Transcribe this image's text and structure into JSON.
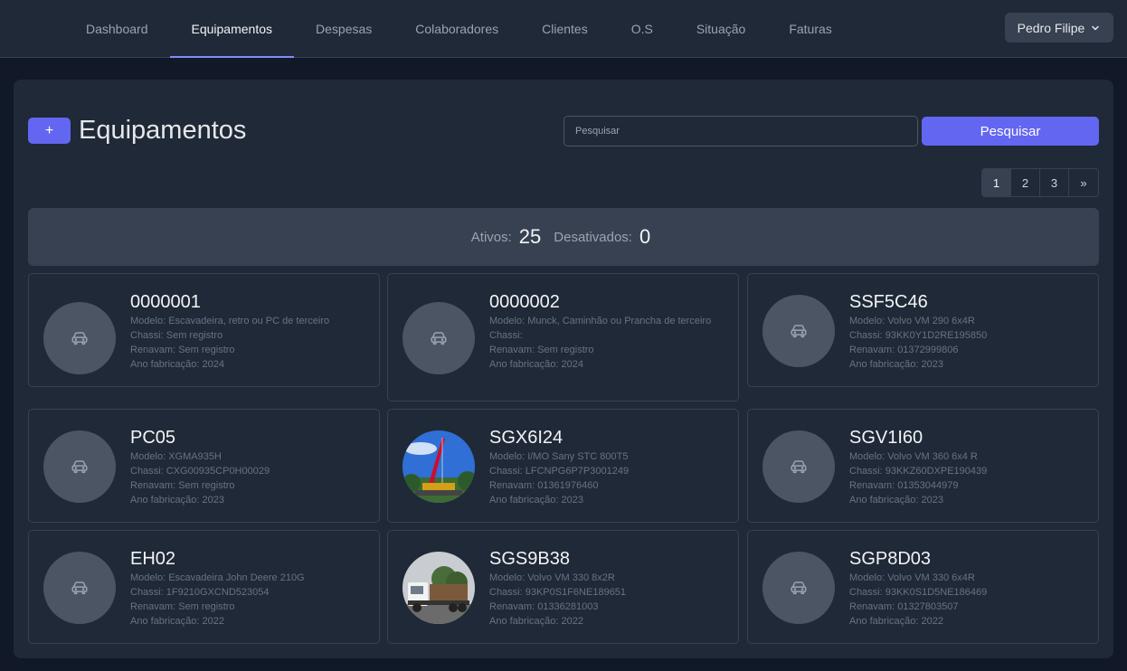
{
  "nav": {
    "items": [
      {
        "label": "Dashboard",
        "active": false
      },
      {
        "label": "Equipamentos",
        "active": true
      },
      {
        "label": "Despesas",
        "active": false
      },
      {
        "label": "Colaboradores",
        "active": false
      },
      {
        "label": "Clientes",
        "active": false
      },
      {
        "label": "O.S",
        "active": false
      },
      {
        "label": "Situação",
        "active": false
      },
      {
        "label": "Faturas",
        "active": false
      }
    ],
    "user_label": "Pedro Filipe"
  },
  "page": {
    "add_label": "+",
    "title": "Equipamentos",
    "search_placeholder": "Pesquisar",
    "search_button": "Pesquisar"
  },
  "pagination": {
    "pages": [
      "1",
      "2",
      "3",
      "»"
    ],
    "current": "1"
  },
  "stats": {
    "active_label": "Ativos:",
    "active_value": "25",
    "inactive_label": "Desativados:",
    "inactive_value": "0"
  },
  "colors": {
    "accent": "#6366f1",
    "panel": "#1f2937",
    "background": "#111827"
  },
  "equipments": [
    {
      "plate": "0000001",
      "modelo": "Modelo: Escavadeira, retro ou PC de terceiro",
      "chassi": "Chassi: Sem registro",
      "renavam": "Renavam: Sem registro",
      "ano": "Ano fabricação: 2024",
      "image": "car-icon"
    },
    {
      "plate": "0000002",
      "modelo": "Modelo: Munck, Caminhão ou Prancha de terceiro",
      "chassi": "Chassi:",
      "renavam": "Renavam: Sem registro",
      "ano": "Ano fabricação: 2024",
      "image": "car-icon"
    },
    {
      "plate": "SSF5C46",
      "modelo": "Modelo: Volvo VM 290 6x4R",
      "chassi": "Chassi: 93KK0Y1D2RE195850",
      "renavam": "Renavam: 01372999806",
      "ano": "Ano fabricação: 2023",
      "image": "car-icon"
    },
    {
      "plate": "PC05",
      "modelo": "Modelo: XGMA935H",
      "chassi": "Chassi: CXG00935CP0H00029",
      "renavam": "Renavam: Sem registro",
      "ano": "Ano fabricação: 2023",
      "image": "car-icon"
    },
    {
      "plate": "SGX6I24",
      "modelo": "Modelo: I/MO Sany STC 800T5",
      "chassi": "Chassi: LFCNPG6P7P3001249",
      "renavam": "Renavam: 01361976460",
      "ano": "Ano fabricação: 2023",
      "image": "crane-photo"
    },
    {
      "plate": "SGV1I60",
      "modelo": "Modelo: Volvo VM 360 6x4 R",
      "chassi": "Chassi: 93KKZ60DXPE190439",
      "renavam": "Renavam: 01353044979",
      "ano": "Ano fabricação: 2023",
      "image": "car-icon"
    },
    {
      "plate": "EH02",
      "modelo": "Modelo: Escavadeira John Deere 210G",
      "chassi": "Chassi: 1F9210GXCND523054",
      "renavam": "Renavam: Sem registro",
      "ano": "Ano fabricação: 2022",
      "image": "car-icon"
    },
    {
      "plate": "SGS9B38",
      "modelo": "Modelo: Volvo VM 330 8x2R",
      "chassi": "Chassi: 93KP0S1F6NE189651",
      "renavam": "Renavam: 01336281003",
      "ano": "Ano fabricação: 2022",
      "image": "truck-photo"
    },
    {
      "plate": "SGP8D03",
      "modelo": "Modelo: Volvo VM 330 6x4R",
      "chassi": "Chassi: 93KK0S1D5NE186469",
      "renavam": "Renavam: 01327803507",
      "ano": "Ano fabricação: 2022",
      "image": "car-icon"
    }
  ]
}
